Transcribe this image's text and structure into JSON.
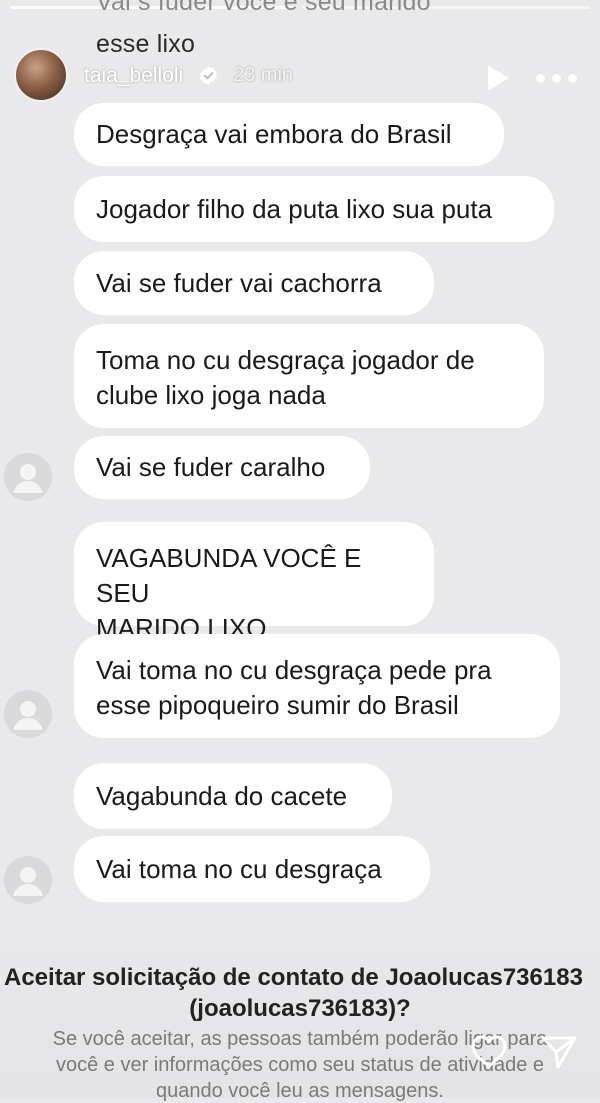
{
  "previous_message": {
    "line1": "Vai s fuder você e seu marido",
    "line2": "esse lixo"
  },
  "story_header": {
    "username": "taia_belloli",
    "time": "23 min",
    "verified_icon": "verified-badge-icon",
    "play_icon": "play-icon",
    "more_icon": "more-options-icon"
  },
  "messages": [
    {
      "lines": [
        "Desgraça vai embora do Brasil"
      ]
    },
    {
      "lines": [
        "Jogador filho da puta lixo sua puta"
      ]
    },
    {
      "lines": [
        "Vai se fuder vai cachorra"
      ]
    },
    {
      "lines": [
        "Toma no cu desgraça jogador de",
        "clube lixo joga nada"
      ]
    },
    {
      "lines": [
        "Vai se fuder caralho"
      ]
    },
    {
      "lines": [
        "VAGABUNDA VOCÊ E SEU",
        "MARIDO LIXO DESGRAÇA"
      ]
    },
    {
      "lines": [
        "Vai toma no cu desgraça pede pra",
        "esse pipoqueiro sumir do Brasil"
      ]
    },
    {
      "lines": [
        "Vagabunda do cacete"
      ]
    },
    {
      "lines": [
        "Vai toma no cu desgraça"
      ]
    }
  ],
  "request": {
    "title_line1": "Aceitar solicitação de contato de Joaolucas736183",
    "title_line2": "(joaolucas736183)?",
    "body_line1": "Se você aceitar, as pessoas também poderão ligar para",
    "body_line2": "você e ver informações como seu status de atividade e",
    "body_line3": "quando você leu as mensagens."
  },
  "footer_icons": [
    "heart-icon",
    "send-icon"
  ],
  "colors": {
    "background": "#e9e9eb",
    "bubble": "#ffffff",
    "text": "#1a1a1a",
    "muted_text": "#7a7a7a",
    "overlay_text": "#ffffff"
  }
}
